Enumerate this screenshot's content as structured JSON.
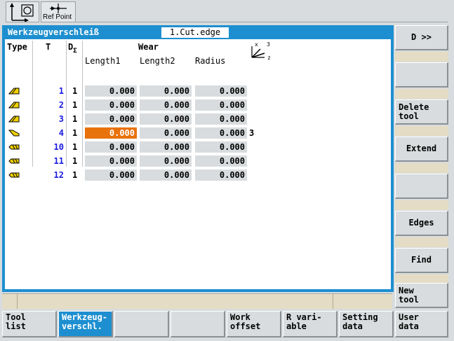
{
  "topbar": {
    "refpoint_label": "Ref Point"
  },
  "window": {
    "title": "Werkzeugverschleiß",
    "cut_edge": "1.Cut.edge"
  },
  "columns": {
    "type": "Type",
    "t": "T",
    "d": "D",
    "d_sub": "Σ",
    "wear": "Wear",
    "length1": "Length1",
    "length2": "Length2",
    "radius": "Radius"
  },
  "axis_icon": {
    "x": "x",
    "z": "z",
    "three": "3"
  },
  "rows": [
    {
      "t": "1",
      "d": "1",
      "length1": "0.000",
      "length2": "0.000",
      "radius": "0.000",
      "edges": "",
      "icon": "turning-tool-icon"
    },
    {
      "t": "2",
      "d": "1",
      "length1": "0.000",
      "length2": "0.000",
      "radius": "0.000",
      "edges": "",
      "icon": "turning-tool-icon"
    },
    {
      "t": "3",
      "d": "1",
      "length1": "0.000",
      "length2": "0.000",
      "radius": "0.000",
      "edges": "",
      "icon": "turning-tool-icon"
    },
    {
      "t": "4",
      "d": "1",
      "length1": "0.000",
      "length2": "0.000",
      "radius": "0.000",
      "edges": "3",
      "icon": "grooving-tool-icon"
    },
    {
      "t": "10",
      "d": "1",
      "length1": "0.000",
      "length2": "0.000",
      "radius": "0.000",
      "edges": "",
      "icon": "drill-tool-icon"
    },
    {
      "t": "11",
      "d": "1",
      "length1": "0.000",
      "length2": "0.000",
      "radius": "0.000",
      "edges": "",
      "icon": "drill-tool-icon"
    },
    {
      "t": "12",
      "d": "1",
      "length1": "0.000",
      "length2": "0.000",
      "radius": "0.000",
      "edges": "",
      "icon": "drill-tool-icon"
    }
  ],
  "vertical_softkeys": [
    "D >>",
    "",
    "Delete\ntool",
    "Extend",
    "",
    "Edges",
    "Find",
    "New\ntool"
  ],
  "horizontal_softkeys": [
    "Tool\nlist",
    "Werkzeug-\nverschl.",
    "",
    "",
    "Work\noffset",
    "R vari-\nable",
    "Setting\ndata",
    "User\ndata"
  ],
  "colors": {
    "accent": "#1d8fd0",
    "active_cell": "#e8720c",
    "tool_number": "#1a1ae0"
  }
}
